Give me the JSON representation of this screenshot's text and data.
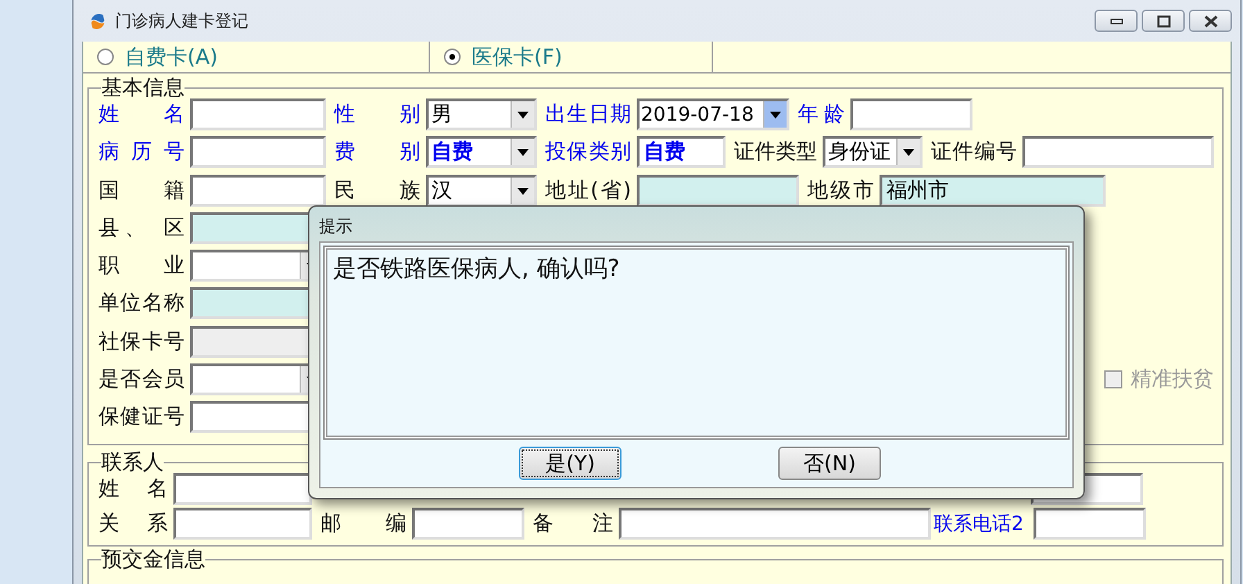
{
  "window": {
    "title": "门诊病人建卡登记"
  },
  "card_types": [
    {
      "label": "自费卡(A)",
      "selected": false
    },
    {
      "label": "医保卡(F)",
      "selected": true
    }
  ],
  "basic_info": {
    "title": "基本信息",
    "rows": [
      [
        {
          "label": "姓 名",
          "highlight": true,
          "kind": "input"
        },
        {
          "label": "性 别",
          "highlight": true,
          "kind": "combo",
          "value": "男"
        },
        {
          "label": "出生日期",
          "highlight": true,
          "kind": "date",
          "value": "2019-07-18"
        },
        {
          "label": "年龄",
          "highlight": true,
          "kind": "input"
        }
      ],
      [
        {
          "label": "病 历 号",
          "highlight": true,
          "kind": "input"
        },
        {
          "label": "费 别",
          "highlight": true,
          "kind": "combo",
          "value": "自费",
          "emphasis": true
        },
        {
          "label": "投保类别",
          "highlight": true,
          "kind": "input",
          "value": "自费",
          "emphasis": true
        },
        {
          "label": "证件类型",
          "highlight": false,
          "kind": "combo",
          "value": "身份证"
        },
        {
          "label": "证件编号",
          "highlight": false,
          "kind": "input"
        }
      ],
      [
        {
          "label": "国 籍",
          "highlight": false,
          "kind": "input"
        },
        {
          "label": "民 族",
          "highlight": false,
          "kind": "combo",
          "value": "汉"
        },
        {
          "label": "地址(省)",
          "highlight": false,
          "kind": "input",
          "color": "#d2f0ee"
        },
        {
          "label": "地级市",
          "highlight": false,
          "kind": "input",
          "value": "福州市",
          "color": "#d2f0ee"
        }
      ],
      [
        {
          "label": "县、 区",
          "highlight": false,
          "kind": "input",
          "color": "#d2f0ee"
        }
      ],
      [
        {
          "label": "职 业",
          "highlight": false,
          "kind": "combo"
        }
      ],
      [
        {
          "label": "单位名称",
          "highlight": false,
          "kind": "input",
          "color": "#d2f0ee"
        }
      ],
      [
        {
          "label": "社保卡号",
          "highlight": false,
          "kind": "input",
          "color": "#eeeeee"
        }
      ],
      [
        {
          "label": "是否会员",
          "highlight": false,
          "kind": "combo"
        },
        {
          "label": "精准扶贫",
          "kind": "checkbox",
          "checked": false,
          "disabled": true
        }
      ],
      [
        {
          "label": "保健证号",
          "highlight": false,
          "kind": "input"
        }
      ]
    ]
  },
  "contact": {
    "title": "联系人",
    "rows": [
      [
        {
          "label": "姓 名",
          "highlight": false,
          "kind": "input"
        },
        {
          "kind": "input"
        }
      ],
      [
        {
          "label": "关 系",
          "highlight": false,
          "kind": "input"
        },
        {
          "label": "邮 编",
          "highlight": false,
          "kind": "input"
        },
        {
          "label": "备 注",
          "highlight": false,
          "kind": "input"
        },
        {
          "label": "联系电话2",
          "highlight": true,
          "kind": "input"
        }
      ]
    ]
  },
  "deposit": {
    "title": "预交金信息"
  },
  "dialog": {
    "title": "提示",
    "message": "是否铁路医保病人, 确认吗?",
    "buttons": [
      {
        "label": "是(Y)",
        "focused": true
      },
      {
        "label": "否(N)",
        "focused": false
      }
    ]
  }
}
